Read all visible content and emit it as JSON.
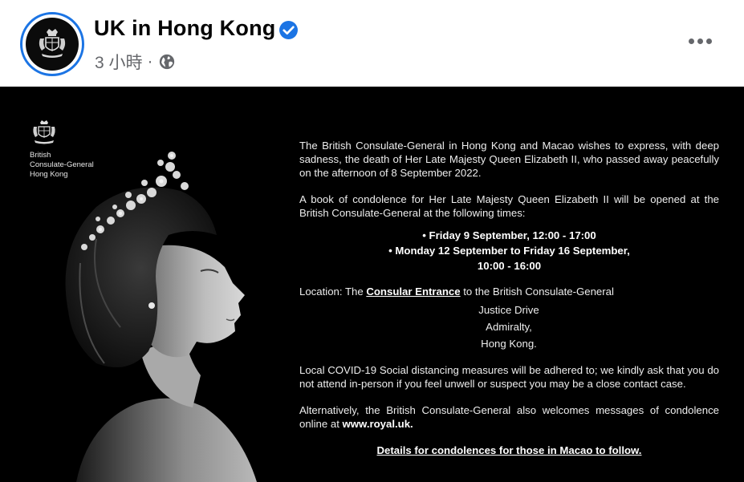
{
  "post": {
    "page_name": "UK in Hong Kong",
    "time": "3 小時",
    "separator": "·",
    "privacy_icon": "globe-icon",
    "verified_icon": "verified-badge-icon",
    "more_icon": "more-options-icon"
  },
  "image": {
    "crest_lines": [
      "British",
      "Consulate-General",
      "Hong Kong"
    ],
    "para1": "The British Consulate-General in Hong Kong and Macao wishes to express, with deep sadness, the death of Her Late Majesty Queen Elizabeth II, who passed away peacefully on the afternoon of 8 September 2022.",
    "para2": "A book of condolence for Her Late Majesty Queen Elizabeth II will be opened at the British Consulate-General at the following times:",
    "bullet1": "• Friday 9 September, 12:00 - 17:00",
    "bullet2": "• Monday 12 September to Friday 16 September,",
    "bullet2_cont": "10:00 - 16:00",
    "location_prefix": "Location: The ",
    "location_link": "Consular Entrance",
    "location_suffix": " to the British Consulate-General",
    "address": [
      "Justice Drive",
      "Admiralty,",
      "Hong Kong."
    ],
    "para_covid": "Local COVID-19 Social distancing measures will be adhered to; we kindly ask that you do not attend in-person if you feel unwell or suspect you may be a close contact case.",
    "para_online_prefix": "Alternatively, the British Consulate-General also welcomes messages of condolence online at ",
    "para_online_link": "www.royal.uk.",
    "macao_note": "Details for condolences for those in Macao to follow."
  },
  "colors": {
    "brand_blue": "#1b74e4",
    "secondary_text": "#65676b",
    "image_bg": "#000000"
  }
}
